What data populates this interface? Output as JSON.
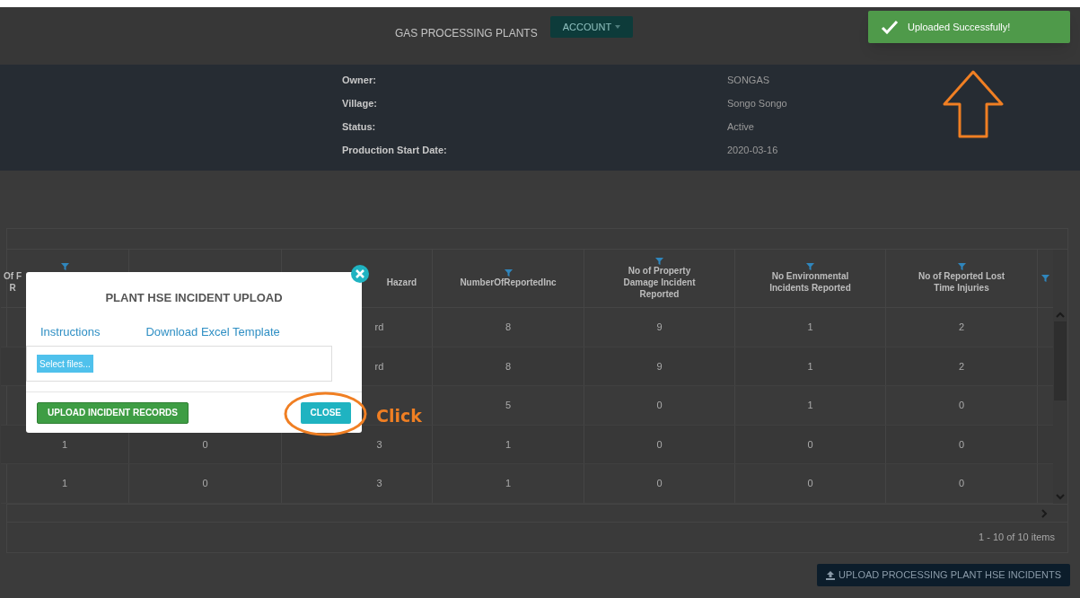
{
  "header": {
    "title": "GAS PROCESSING PLANTS",
    "account_button": "ACCOUNT"
  },
  "plant_details": [
    {
      "label": "Owner:",
      "value": "SONGAS"
    },
    {
      "label": "Village:",
      "value": "Songo Songo"
    },
    {
      "label": "Status:",
      "value": "Active"
    },
    {
      "label": "Production Start Date:",
      "value": "2020-03-16"
    }
  ],
  "toast": {
    "message": "Uploaded Successfully!"
  },
  "table": {
    "columns": [
      {
        "lines": [
          "Of F",
          "R"
        ]
      },
      {},
      {
        "lines": [
          "Hazard"
        ]
      },
      {
        "lines": [
          "NumberOfReportedInc"
        ]
      },
      {
        "lines": [
          "No of Property",
          "Damage Incident",
          "Reported"
        ]
      },
      {
        "lines": [
          "No Environmental",
          "Incidents Reported"
        ]
      },
      {
        "lines": [
          "No of Reported Lost",
          "Time Injuries"
        ]
      },
      {}
    ],
    "rows": [
      [
        null,
        null,
        "rd",
        "8",
        "9",
        "1",
        "2"
      ],
      [
        null,
        null,
        "rd",
        "8",
        "9",
        "1",
        "2"
      ],
      [
        null,
        null,
        null,
        "5",
        "0",
        "1",
        "0"
      ],
      [
        "1",
        "0",
        "3",
        "1",
        "0",
        "0",
        "0"
      ],
      [
        "1",
        "0",
        "3",
        "1",
        "0",
        "0",
        "0"
      ]
    ],
    "summary": "1 - 10 of 10 items"
  },
  "upload_button": "UPLOAD PROCESSING PLANT HSE INCIDENTS",
  "modal": {
    "title": "PLANT HSE INCIDENT UPLOAD",
    "links": [
      "Instructions",
      "Download Excel Template"
    ],
    "file_button": "Select files...",
    "upload_button": "UPLOAD INCIDENT RECORDS",
    "close_button": "CLOSE"
  },
  "annotation": {
    "label": "Click"
  }
}
